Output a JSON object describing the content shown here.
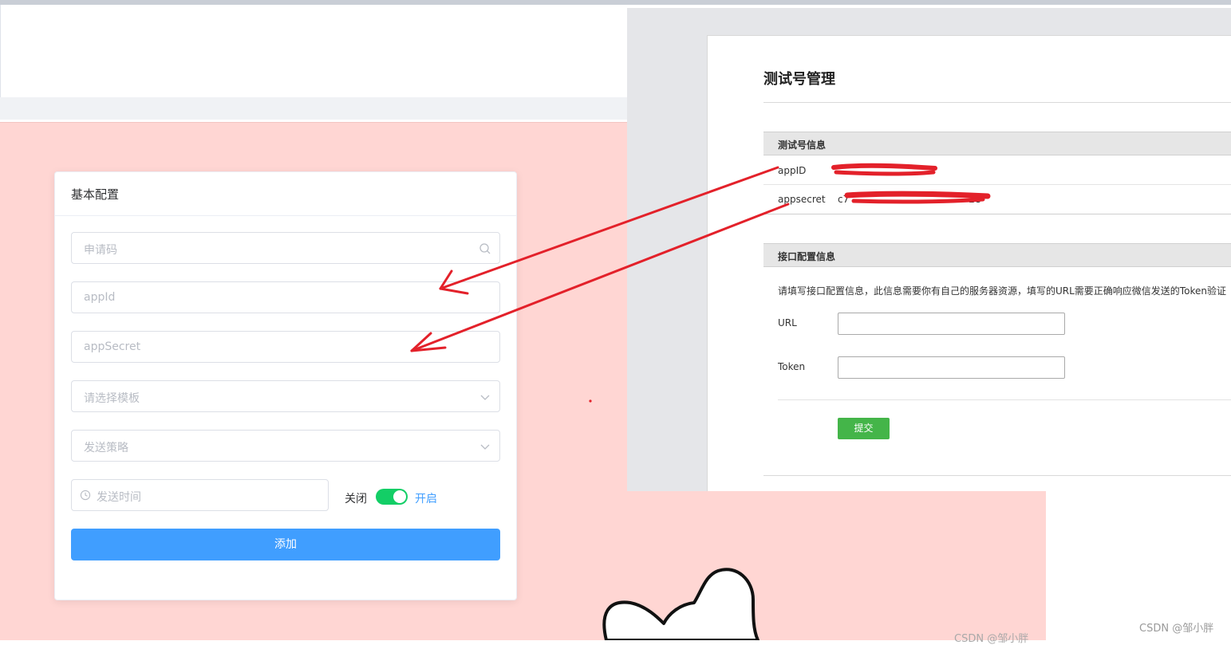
{
  "left_form": {
    "card_title": "基本配置",
    "apply_code_placeholder": "申请码",
    "appid_placeholder": "appId",
    "appsecret_placeholder": "appSecret",
    "template_placeholder": "请选择模板",
    "strategy_placeholder": "发送策略",
    "time_placeholder": "发送时间",
    "switch_off_label": "关闭",
    "switch_on_label": "开启",
    "switch_state": "on",
    "add_button_label": "添加",
    "icons": [
      "search-icon",
      "chevron-down-icon",
      "chevron-down-icon",
      "clock-icon"
    ]
  },
  "right_panel": {
    "title": "测试号管理",
    "info_section_title": "测试号信息",
    "appid_label": "appID",
    "appid_value": "",
    "appsecret_label": "appsecret",
    "appsecret_value_visible": "c7",
    "appsecret_value_tail": "2e",
    "api_section_title": "接口配置信息",
    "api_description": "请填写接口配置信息，此信息需要你有自己的服务器资源，填写的URL需要正确响应微信发送的Token验证",
    "url_label": "URL",
    "url_value": "",
    "token_label": "Token",
    "token_value": "",
    "submit_label": "提交"
  },
  "watermarks": {
    "bottom_center": "CSDN @邹小胖",
    "bottom_right": "CSDN @邹小胖"
  },
  "colors": {
    "pink_background": "#ffd6d3",
    "primary_blue": "#409eff",
    "switch_green": "#13ce66",
    "submit_green": "#44b549",
    "annotation_red": "#e3212a"
  }
}
